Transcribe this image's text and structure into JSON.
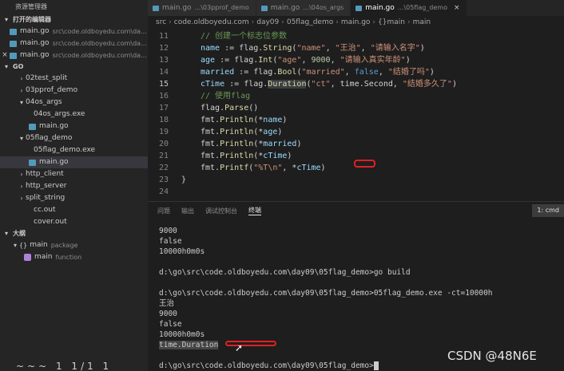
{
  "sidebar": {
    "title": "资源管理器",
    "open_editors_label": "打开的编辑器",
    "open_editors": [
      {
        "name": "main.go",
        "path": "src\\code.oldboyedu.com\\da..."
      },
      {
        "name": "main.go",
        "path": "src\\code.oldboyedu.com\\da..."
      },
      {
        "name": "main.go",
        "path": "src\\code.oldboyedu.com\\da..."
      }
    ],
    "folder_label": "GO",
    "tree": [
      {
        "label": "02test_split",
        "depth": 1,
        "kind": "folder",
        "open": false
      },
      {
        "label": "03pprof_demo",
        "depth": 1,
        "kind": "folder",
        "open": false
      },
      {
        "label": "04os_args",
        "depth": 1,
        "kind": "folder",
        "open": true
      },
      {
        "label": "04os_args.exe",
        "depth": 2,
        "kind": "file"
      },
      {
        "label": "main.go",
        "depth": 2,
        "kind": "go"
      },
      {
        "label": "05flag_demo",
        "depth": 1,
        "kind": "folder",
        "open": true
      },
      {
        "label": "05flag_demo.exe",
        "depth": 2,
        "kind": "file"
      },
      {
        "label": "main.go",
        "depth": 2,
        "kind": "go",
        "selected": true
      },
      {
        "label": "http_client",
        "depth": 1,
        "kind": "folder",
        "open": false
      },
      {
        "label": "http_server",
        "depth": 1,
        "kind": "folder",
        "open": false
      },
      {
        "label": "split_string",
        "depth": 1,
        "kind": "folder",
        "open": false
      },
      {
        "label": "cc.out",
        "depth": 2,
        "kind": "file"
      },
      {
        "label": "cover.out",
        "depth": 2,
        "kind": "file"
      }
    ],
    "outline_label": "大纲",
    "outline": [
      {
        "name": "main",
        "kind": "package"
      },
      {
        "name": "main",
        "kind": "function"
      }
    ]
  },
  "tabs": [
    {
      "name": "main.go",
      "path": "...\\03pprof_demo",
      "active": false
    },
    {
      "name": "main.go",
      "path": "...\\04os_args",
      "active": false
    },
    {
      "name": "main.go",
      "path": "...\\05flag_demo",
      "active": true
    }
  ],
  "breadcrumb": [
    "src",
    "code.oldboyedu.com",
    "day09",
    "05flag_demo",
    "main.go",
    "{}main",
    "main"
  ],
  "code_lines": [
    {
      "n": "11",
      "html": "<span class=\"cmt\">// 创建一个标志位参数</span>"
    },
    {
      "n": "12",
      "html": "<span class=\"var\">name</span> := flag.<span class=\"fn\">String</span>(<span class=\"str\">\"name\"</span>, <span class=\"str\">\"王治\"</span>, <span class=\"str\">\"请输入名字\"</span>)"
    },
    {
      "n": "13",
      "html": "<span class=\"var\">age</span> := flag.<span class=\"fn\">Int</span>(<span class=\"str\">\"age\"</span>, <span class=\"num\">9000</span>, <span class=\"str\">\"请输入真实年龄\"</span>)"
    },
    {
      "n": "14",
      "html": "<span class=\"var\">married</span> := flag.<span class=\"fn\">Bool</span>(<span class=\"str\">\"married\"</span>, <span class=\"kw\">false</span>, <span class=\"str\">\"结婚了吗\"</span>)"
    },
    {
      "n": "15",
      "html": "<span class=\"var\">cTime</span> := flag.<span class=\"fn sel\">Duration</span>(<span class=\"str\">\"ct\"</span>, time.Second, <span class=\"str\">\"结婚多久了\"</span>)"
    },
    {
      "n": "16",
      "html": "<span class=\"cmt\">// 使用flag</span>"
    },
    {
      "n": "17",
      "html": "flag.<span class=\"fn\">Parse</span>()"
    },
    {
      "n": "18",
      "html": "fmt.<span class=\"fn\">Println</span>(*<span class=\"var\">name</span>)"
    },
    {
      "n": "19",
      "html": "fmt.<span class=\"fn\">Println</span>(*<span class=\"var\">age</span>)"
    },
    {
      "n": "20",
      "html": "fmt.<span class=\"fn\">Println</span>(*<span class=\"var\">married</span>)"
    },
    {
      "n": "21",
      "html": "fmt.<span class=\"fn\">Println</span>(*<span class=\"var\">cTime</span>)"
    },
    {
      "n": "22",
      "html": "fmt.<span class=\"fn\">Printf</span>(<span class=\"str\">\"%T\\n\"</span>, *<span class=\"var\">cTime</span>)"
    },
    {
      "n": "23",
      "html": "}"
    },
    {
      "n": "24",
      "html": ""
    }
  ],
  "current_line": "15",
  "panel": {
    "tabs": [
      "问题",
      "输出",
      "调试控制台",
      "终端"
    ],
    "active_tab": "终端",
    "terminal_select": "1: cmd"
  },
  "terminal_lines": [
    "9000",
    "false",
    "10000h0m0s",
    "",
    "d:\\go\\src\\code.oldboyedu.com\\day09\\05flag_demo>go build",
    "",
    "d:\\go\\src\\code.oldboyedu.com\\day09\\05flag_demo>05flag_demo.exe -ct=10000h",
    "王治",
    "9000",
    "false",
    "10000h0m0s",
    "time.Duration",
    "",
    "d:\\go\\src\\code.oldboyedu.com\\day09\\05flag_demo>"
  ],
  "watermark": "CSDN @48N6E",
  "bottom_glyphs": "~~~ 1 1/1 1"
}
